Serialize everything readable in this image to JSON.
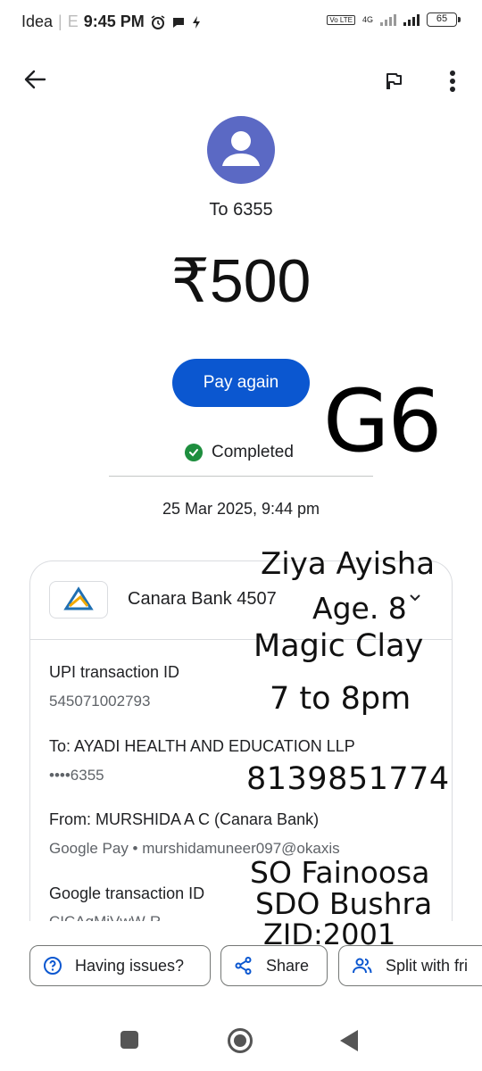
{
  "status_bar": {
    "carrier": "Idea",
    "carrier_extra": "E",
    "time": "9:45 PM",
    "network": "4G",
    "volte": "Vo LTE",
    "battery": "65"
  },
  "header": {
    "recipient": "To 6355",
    "amount": "₹500",
    "pay_again_label": "Pay again",
    "status_text": "Completed",
    "datetime": "25 Mar 2025, 9:44 pm"
  },
  "card": {
    "bank_name": "Canara Bank 4507",
    "rows": [
      {
        "label": "UPI transaction ID",
        "value": "545071002793"
      },
      {
        "label": "To: AYADI HEALTH AND EDUCATION LLP",
        "value": "••••6355"
      },
      {
        "label": "From: MURSHIDA A C (Canara Bank)",
        "value": "Google Pay • murshidamuneer097@okaxis"
      },
      {
        "label": "Google transaction ID",
        "value": "CICAgMiVwW-R"
      }
    ]
  },
  "handwritten": {
    "code": "G6",
    "line1": "Ziya Ayisha",
    "line2": "Age. 8",
    "line3": "Magic Clay",
    "line4": "7 to 8pm",
    "phone": "8139851774",
    "line5": "SO Fainoosa",
    "line6": "SDO Bushra",
    "line7": "ZID:2001"
  },
  "actions": {
    "issues": "Having issues?",
    "share": "Share",
    "split": "Split with fri"
  },
  "colors": {
    "primary": "#0b57d0",
    "avatar": "#5b69c4",
    "success": "#1e8e3e"
  }
}
